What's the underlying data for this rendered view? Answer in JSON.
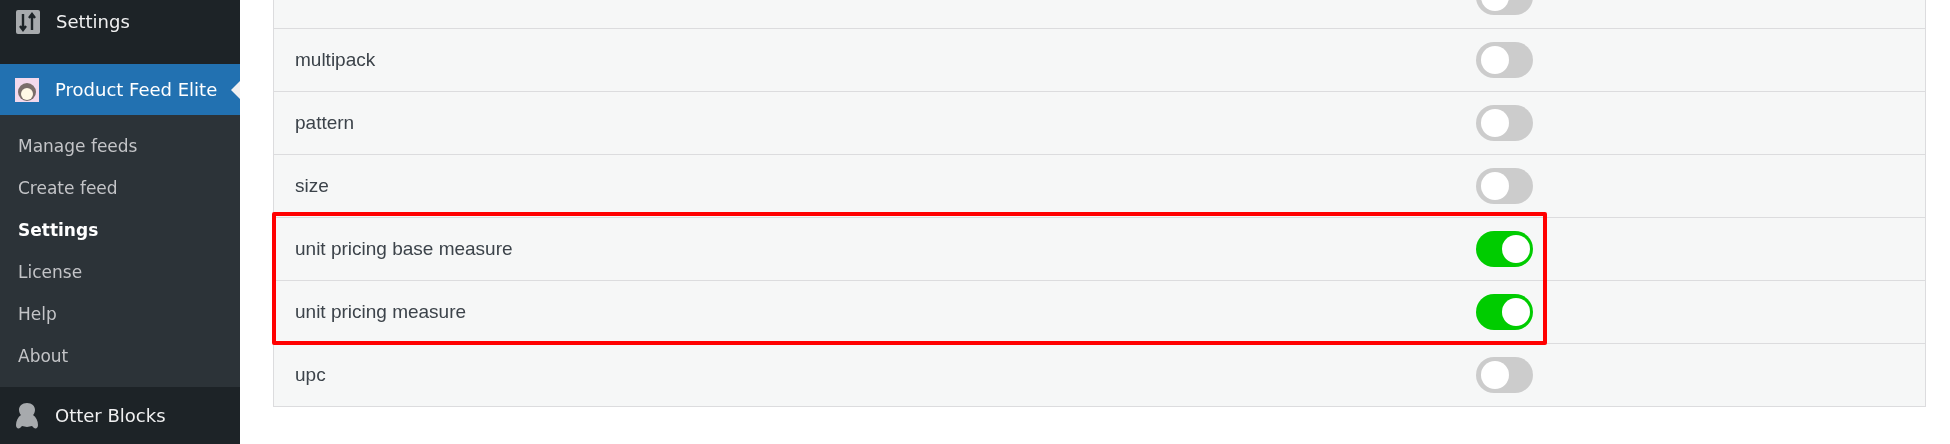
{
  "sidebar": {
    "top_item": {
      "label": "Settings"
    },
    "active_item": {
      "label": "Product Feed Elite"
    },
    "submenu": [
      {
        "label": "Manage feeds",
        "selected": false
      },
      {
        "label": "Create feed",
        "selected": false
      },
      {
        "label": "Settings",
        "selected": true
      },
      {
        "label": "License",
        "selected": false
      },
      {
        "label": "Help",
        "selected": false
      },
      {
        "label": "About",
        "selected": false
      }
    ],
    "bottom_item": {
      "label": "Otter Blocks"
    }
  },
  "attributes": [
    {
      "on": false,
      "highlighted": false
    },
    {
      "label": "multipack",
      "on": false,
      "highlighted": false
    },
    {
      "label": "pattern",
      "on": false,
      "highlighted": false
    },
    {
      "label": "size",
      "on": false,
      "highlighted": false
    },
    {
      "label": "unit pricing base measure",
      "on": true,
      "highlighted": true
    },
    {
      "label": "unit pricing measure",
      "on": true,
      "highlighted": true
    },
    {
      "label": "upc",
      "on": false,
      "highlighted": false
    }
  ]
}
